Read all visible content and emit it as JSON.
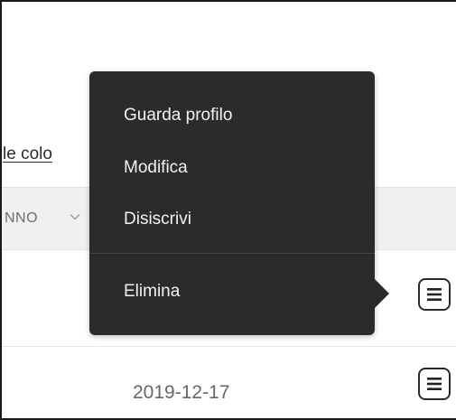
{
  "table": {
    "partial_link": "le colo",
    "column_header_label": "NNO",
    "row2_date": "2019-12-17"
  },
  "context_menu": {
    "items": [
      {
        "label": "Guarda profilo"
      },
      {
        "label": "Modifica"
      },
      {
        "label": "Disiscrivi"
      },
      {
        "label": "Elimina"
      }
    ]
  },
  "icons": {
    "row_menu": "hamburger-menu-icon",
    "sort": "chevron-down-icon"
  },
  "colors": {
    "menu_bg": "#2b2b2b",
    "menu_text": "#f2f2f2",
    "header_band": "#f0f0f0"
  }
}
